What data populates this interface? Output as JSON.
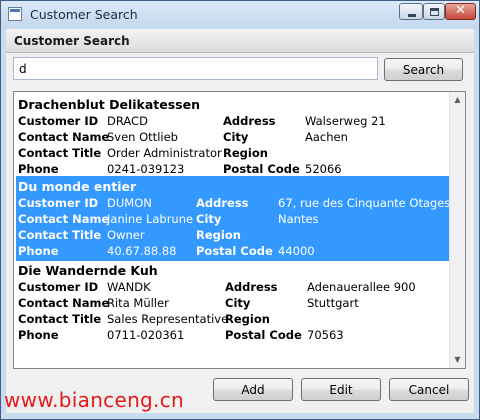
{
  "window": {
    "title": "Customer Search",
    "caption_close": "✕"
  },
  "header": {
    "title": "Customer Search"
  },
  "search": {
    "value": "d",
    "button_label": "Search"
  },
  "labels": {
    "customer_id": "Customer ID",
    "contact_name": "Contact Name",
    "contact_title": "Contact Title",
    "phone": "Phone",
    "address": "Address",
    "city": "City",
    "region": "Region",
    "postal_code": "Postal Code"
  },
  "customers": [
    {
      "company_name": "Drachenblut Delikatessen",
      "customer_id": "DRACD",
      "contact_name": "Sven Ottlieb",
      "contact_title": "Order Administrator",
      "phone": "0241-039123",
      "address": "Walserweg 21",
      "city": "Aachen",
      "region": "",
      "postal_code": "52066",
      "selected": false
    },
    {
      "company_name": "Du monde entier",
      "customer_id": "DUMON",
      "contact_name": "Janine Labrune",
      "contact_title": "Owner",
      "phone": "40.67.88.88",
      "address": "67, rue des Cinquante Otages",
      "city": "Nantes",
      "region": "",
      "postal_code": "44000",
      "selected": true
    },
    {
      "company_name": "Die Wandernde Kuh",
      "customer_id": "WANDK",
      "contact_name": "Rita Müller",
      "contact_title": "Sales Representative",
      "phone": "0711-020361",
      "address": "Adenauerallee 900",
      "city": "Stuttgart",
      "region": "",
      "postal_code": "70563",
      "selected": false
    }
  ],
  "buttons": {
    "add": "Add",
    "edit": "Edit",
    "cancel": "Cancel"
  },
  "watermark": "www.bianceng.cn",
  "colors": {
    "selection": "#3399ff",
    "watermark": "#e51a1a"
  }
}
